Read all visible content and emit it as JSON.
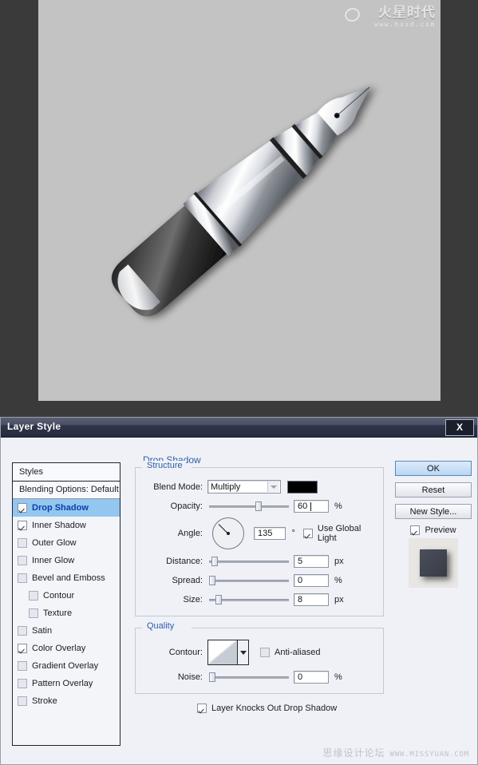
{
  "canvas": {
    "background_color": "#c3c3c3",
    "artwork_name": "fountain-pen-illustration",
    "watermark": {
      "chinese": "火星时代",
      "url": "www.hxsd.com"
    }
  },
  "dialog": {
    "title": "Layer Style",
    "close_label": "X",
    "styles_panel": {
      "header": "Styles",
      "blending_options": "Blending Options: Default",
      "items": [
        {
          "label": "Drop Shadow",
          "checked": true,
          "selected": true,
          "indent": false
        },
        {
          "label": "Inner Shadow",
          "checked": true,
          "selected": false,
          "indent": false
        },
        {
          "label": "Outer Glow",
          "checked": false,
          "selected": false,
          "indent": false
        },
        {
          "label": "Inner Glow",
          "checked": false,
          "selected": false,
          "indent": false
        },
        {
          "label": "Bevel and Emboss",
          "checked": false,
          "selected": false,
          "indent": false
        },
        {
          "label": "Contour",
          "checked": false,
          "selected": false,
          "indent": true
        },
        {
          "label": "Texture",
          "checked": false,
          "selected": false,
          "indent": true
        },
        {
          "label": "Satin",
          "checked": false,
          "selected": false,
          "indent": false
        },
        {
          "label": "Color Overlay",
          "checked": true,
          "selected": false,
          "indent": false
        },
        {
          "label": "Gradient Overlay",
          "checked": false,
          "selected": false,
          "indent": false
        },
        {
          "label": "Pattern Overlay",
          "checked": false,
          "selected": false,
          "indent": false
        },
        {
          "label": "Stroke",
          "checked": false,
          "selected": false,
          "indent": false
        }
      ]
    },
    "panel": {
      "section_title": "Drop Shadow",
      "structure": {
        "legend": "Structure",
        "blend_mode_label": "Blend Mode:",
        "blend_mode_value": "Multiply",
        "shadow_color": "#000000",
        "opacity_label": "Opacity:",
        "opacity_value": "60",
        "opacity_unit": "%",
        "angle_label": "Angle:",
        "angle_value": "135",
        "angle_unit": "°",
        "use_global_light_label": "Use Global Light",
        "use_global_light_checked": true,
        "distance_label": "Distance:",
        "distance_value": "5",
        "distance_unit": "px",
        "spread_label": "Spread:",
        "spread_value": "0",
        "spread_unit": "%",
        "size_label": "Size:",
        "size_value": "8",
        "size_unit": "px"
      },
      "quality": {
        "legend": "Quality",
        "contour_label": "Contour:",
        "anti_aliased_label": "Anti-aliased",
        "anti_aliased_checked": false,
        "noise_label": "Noise:",
        "noise_value": "0",
        "noise_unit": "%"
      },
      "knockout_label": "Layer Knocks Out Drop Shadow",
      "knockout_checked": true
    },
    "buttons": {
      "ok": "OK",
      "reset": "Reset",
      "new_style": "New Style...",
      "preview_label": "Preview",
      "preview_checked": true
    },
    "watermark": {
      "chinese": "思缘设计论坛",
      "url": "WWW.MISSYUAN.COM"
    }
  }
}
